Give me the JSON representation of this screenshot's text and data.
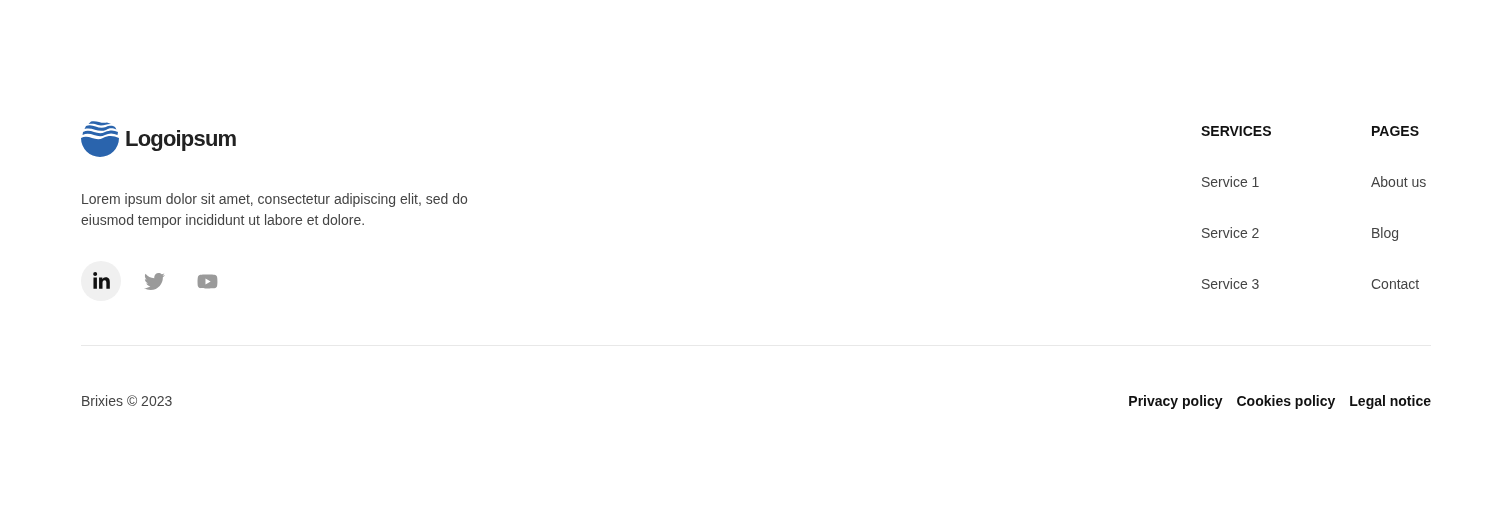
{
  "brand": {
    "name": "Logoipsum"
  },
  "description": "Lorem ipsum dolor sit amet, consectetur adipiscing elit, sed do eiusmod tempor incididunt ut labore et dolore.",
  "social": [
    {
      "kind": "linkedin",
      "selected": true
    },
    {
      "kind": "twitter",
      "selected": false
    },
    {
      "kind": "youtube",
      "selected": false
    }
  ],
  "columns": [
    {
      "heading": "SERVICES",
      "links": [
        "Service 1",
        "Service 2",
        "Service 3"
      ]
    },
    {
      "heading": "PAGES",
      "links": [
        "About us",
        "Blog",
        "Contact"
      ]
    }
  ],
  "copyright": "Brixies © 2023",
  "legal_links": [
    "Privacy policy",
    "Cookies policy",
    "Legal notice"
  ]
}
